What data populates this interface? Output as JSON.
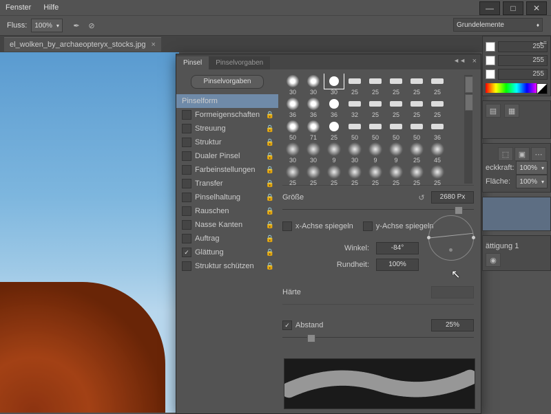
{
  "menu": {
    "fenster": "Fenster",
    "hilfe": "Hilfe"
  },
  "toolbar": {
    "fluss_label": "Fluss:",
    "fluss_value": "100%"
  },
  "workspace": {
    "selected": "Grundelemente"
  },
  "document": {
    "tab_name": "el_wolken_by_archaeopteryx_stocks.jpg"
  },
  "brush_panel": {
    "tabs": {
      "pinsel": "Pinsel",
      "vorgaben": "Pinselvorgaben"
    },
    "preset_btn": "Pinselvorgaben",
    "options": [
      {
        "label": "Pinselform",
        "checked": false,
        "lock": false,
        "sel": true
      },
      {
        "label": "Formeigenschaften",
        "checked": false,
        "lock": true
      },
      {
        "label": "Streuung",
        "checked": false,
        "lock": true
      },
      {
        "label": "Struktur",
        "checked": false,
        "lock": true
      },
      {
        "label": "Dualer Pinsel",
        "checked": false,
        "lock": true
      },
      {
        "label": "Farbeinstellungen",
        "checked": false,
        "lock": true
      },
      {
        "label": "Transfer",
        "checked": false,
        "lock": true
      },
      {
        "label": "Pinselhaltung",
        "checked": false,
        "lock": true
      },
      {
        "label": "Rauschen",
        "checked": false,
        "lock": true
      },
      {
        "label": "Nasse Kanten",
        "checked": false,
        "lock": true
      },
      {
        "label": "Auftrag",
        "checked": false,
        "lock": true
      },
      {
        "label": "Glättung",
        "checked": true,
        "lock": true
      },
      {
        "label": "Struktur schützen",
        "checked": false,
        "lock": true
      }
    ],
    "thumbs": [
      [
        "30",
        "30",
        "30",
        "25",
        "25",
        "25",
        "25",
        "25"
      ],
      [
        "36",
        "36",
        "36",
        "32",
        "25",
        "25",
        "25",
        "25"
      ],
      [
        "50",
        "71",
        "25",
        "50",
        "50",
        "50",
        "50",
        "36"
      ],
      [
        "30",
        "30",
        "9",
        "30",
        "9",
        "9",
        "25",
        "45"
      ],
      [
        "25",
        "25",
        "25",
        "25",
        "25",
        "25",
        "25",
        "25"
      ]
    ],
    "size_label": "Größe",
    "size_value": "2680 Px",
    "flip_x": "x-Achse spiegeln",
    "flip_y": "y-Achse spiegeln",
    "angle_label": "Winkel:",
    "angle_value": "-84°",
    "round_label": "Rundheit:",
    "round_value": "100%",
    "hard_label": "Härte",
    "spacing_label": "Abstand",
    "spacing_value": "25%"
  },
  "right": {
    "ch_values": [
      "255",
      "255",
      "255"
    ],
    "deck_label": "eckkraft:",
    "deck_val": "100%",
    "flae_label": "Fläche:",
    "flae_val": "100%",
    "adjust": "ättigung 1"
  }
}
